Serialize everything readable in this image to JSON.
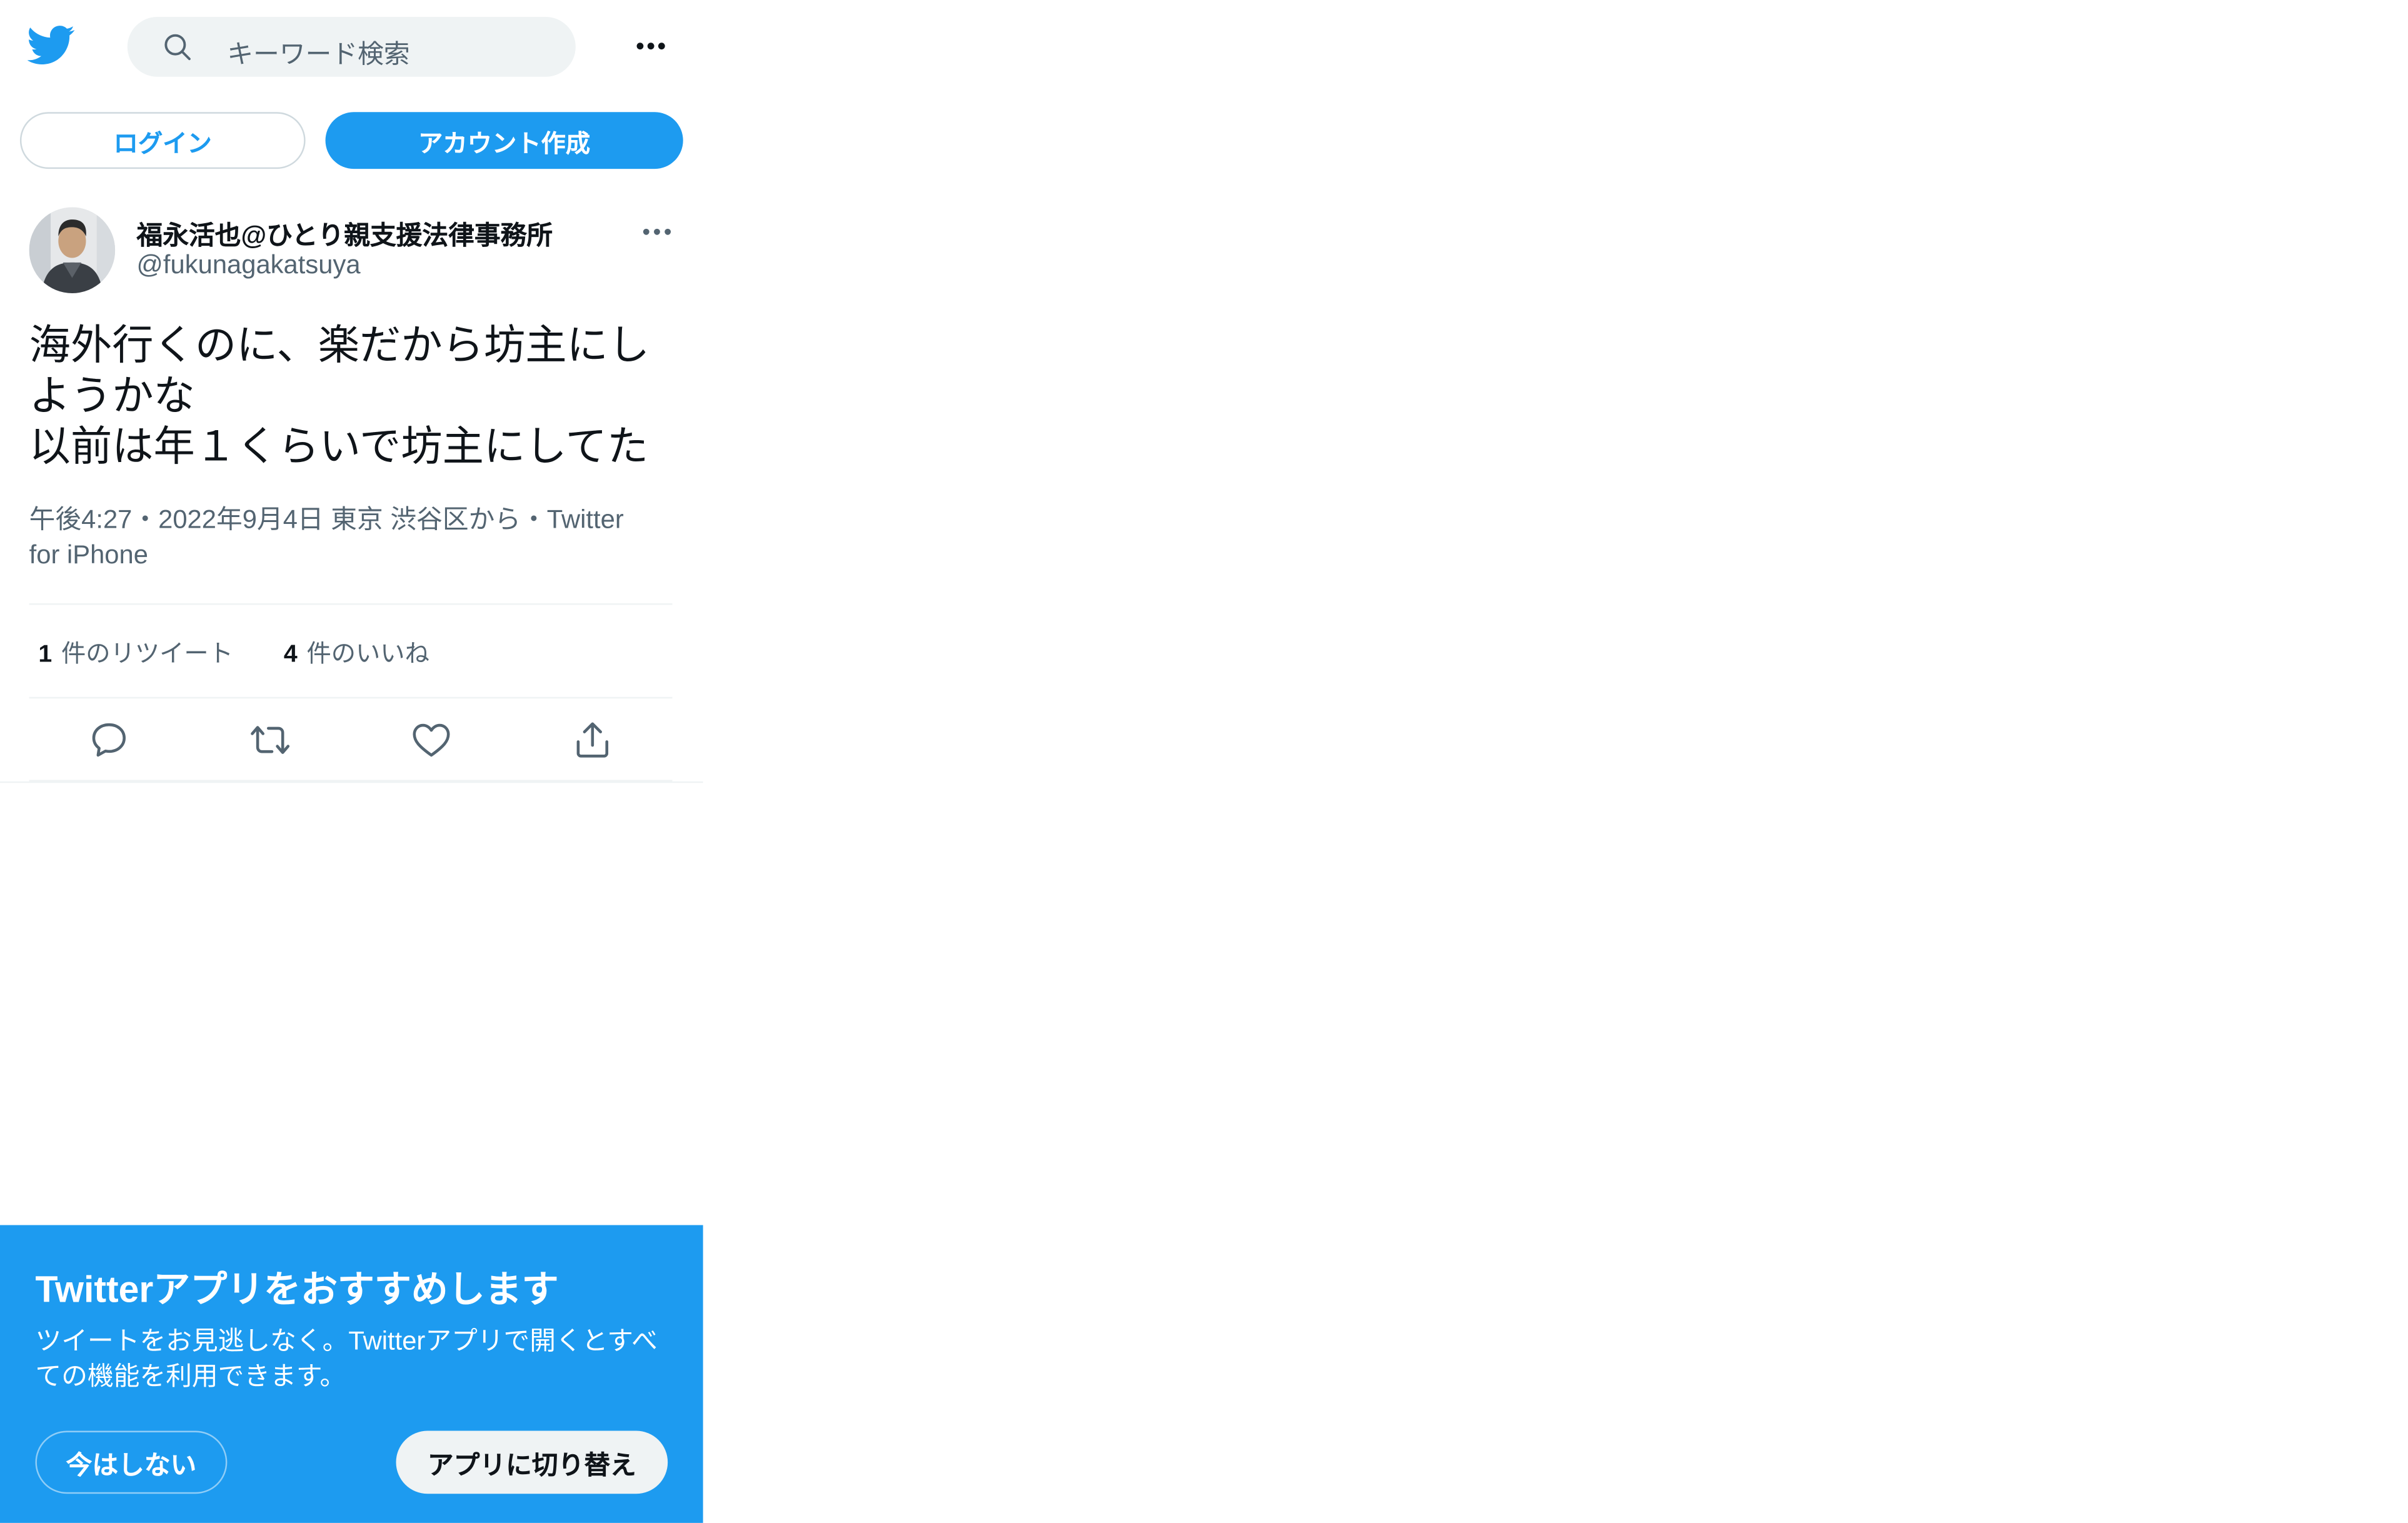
{
  "header": {
    "logo_icon": "twitter-bird-icon",
    "search_placeholder": "キーワード検索",
    "more_icon": "more-horizontal-icon"
  },
  "auth": {
    "login_label": "ログイン",
    "signup_label": "アカウント作成"
  },
  "tweet": {
    "author": {
      "display_name": "福永活也@ひとり親支援法律事務所",
      "handle": "@fukunagakatsuya",
      "avatar_icon": "user-avatar"
    },
    "text_lines": [
      "海外行くのに、楽だから坊主にし",
      "ようかな",
      "以前は年１くらいで坊主にしてた"
    ],
    "meta_line1": "午後4:27・2022年9月4日 東京 渋谷区から・Twitter",
    "meta_line2": "for iPhone",
    "stats": {
      "retweet_count": "1",
      "retweet_label": "件のリツイート",
      "like_count": "4",
      "like_label": "件のいいね"
    },
    "actions": [
      "reply-icon",
      "retweet-icon",
      "like-icon",
      "share-icon"
    ]
  },
  "promo": {
    "title": "Twitterアプリをおすすめします",
    "body": "ツイートをお見逃しなく。Twitterアプリで開くとすべての機能を利用できます。",
    "not_now_label": "今はしない",
    "switch_label": "アプリに切り替え"
  },
  "colors": {
    "brand_blue": "#1d9bf0",
    "text_primary": "#0f1419",
    "text_secondary": "#536471",
    "search_bg": "#eff3f4"
  }
}
